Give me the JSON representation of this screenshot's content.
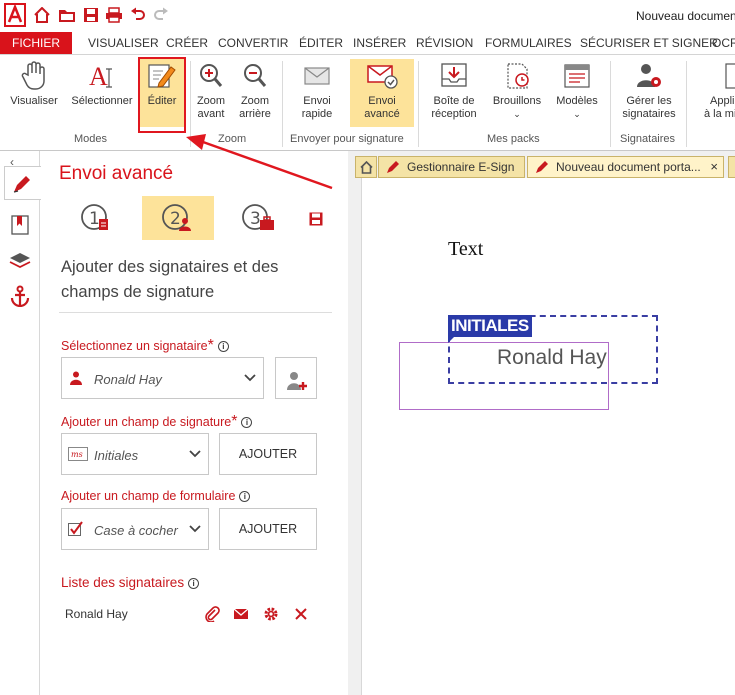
{
  "window": {
    "title": "Nouveau document p"
  },
  "ribbon_tabs": [
    {
      "label": "FICHIER",
      "active": true
    },
    {
      "label": "VISUALISER"
    },
    {
      "label": "CRÉER"
    },
    {
      "label": "CONVERTIR"
    },
    {
      "label": "ÉDITER"
    },
    {
      "label": "INSÉRER"
    },
    {
      "label": "RÉVISION"
    },
    {
      "label": "FORMULAIRES"
    },
    {
      "label": "SÉCURISER ET SIGNER"
    },
    {
      "label": "OCR"
    }
  ],
  "ribbon": {
    "buttons": {
      "visualiser": "Visualiser",
      "selectionner": "Sélectionner",
      "editer": "Éditer",
      "zoom_avant_1": "Zoom",
      "zoom_avant_2": "avant",
      "zoom_arriere_1": "Zoom",
      "zoom_arriere_2": "arrière",
      "envoi_rapide_1": "Envoi",
      "envoi_rapide_2": "rapide",
      "envoi_avance_1": "Envoi",
      "envoi_avance_2": "avancé",
      "boite_1": "Boîte de",
      "boite_2": "réception",
      "brouillons": "Brouillons",
      "modeles": "Modèles",
      "gerer_1": "Gérer les",
      "gerer_2": "signataires",
      "appliquer_1": "Appli",
      "appliquer_2": "à la mise"
    },
    "groups": {
      "modes": "Modes",
      "zoom": "Zoom",
      "envoyer": "Envoyer pour signature",
      "packs": "Mes packs",
      "signataires": "Signataires"
    }
  },
  "panel": {
    "title": "Envoi avancé",
    "steps": [
      "1",
      "2",
      "3"
    ],
    "subtitle": "Ajouter des signataires et des champs de signature",
    "select_signer_label": "Sélectionnez un signataire",
    "select_signer_value": "Ronald Hay",
    "add_sig_field_label": "Ajouter un champ de signature",
    "sig_field_value": "Initiales",
    "add_button": "AJOUTER",
    "add_form_field_label": "Ajouter un champ de formulaire",
    "form_field_value": "Case à cocher",
    "add_button_2": "AJOUTER",
    "signers_list_title": "Liste des signataires",
    "signers": [
      {
        "name": "Ronald Hay"
      }
    ],
    "required_mark": "*",
    "info_mark": "i"
  },
  "doc_tabs": [
    {
      "label": "Gestionnaire E-Sign"
    },
    {
      "label": "Nouveau document porta..."
    }
  ],
  "document": {
    "text": "Text",
    "initials_tag": "INITIALES",
    "signer_name": "Ronald Hay"
  },
  "colors": {
    "brand_red": "#d9131b",
    "highlight": "#fde39a",
    "field_blue": "#2a3aa8"
  },
  "icons": [
    "home-icon",
    "folder-icon",
    "save-icon",
    "print-icon",
    "undo-icon",
    "redo-icon",
    "hand-icon",
    "text-cursor-icon",
    "pencil-icon",
    "zoom-in-icon",
    "zoom-out-icon",
    "mail-icon",
    "mail-advanced-icon",
    "inbox-icon",
    "drafts-icon",
    "templates-icon",
    "signers-gear-icon",
    "paperclip-icon",
    "gear-icon",
    "close-icon"
  ]
}
